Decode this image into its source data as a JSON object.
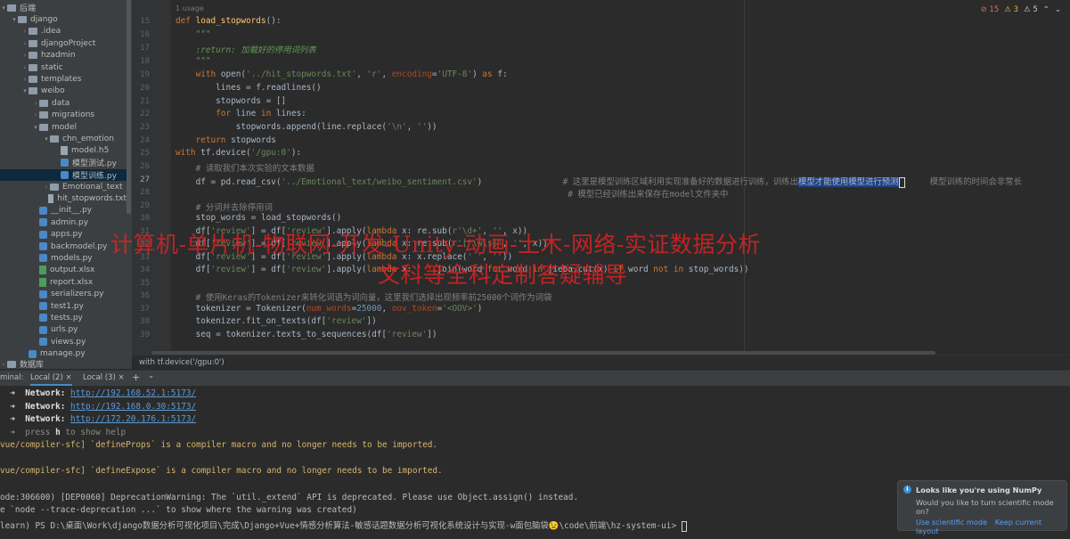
{
  "project_tree": {
    "items": [
      {
        "label": "后端",
        "depth": 0,
        "arrow": "▾",
        "icon": "folder-icon"
      },
      {
        "label": "django",
        "depth": 1,
        "arrow": "▾",
        "icon": "folder-icon"
      },
      {
        "label": ".idea",
        "depth": 2,
        "arrow": "›",
        "icon": "folder-icon"
      },
      {
        "label": "djangoProject",
        "depth": 2,
        "arrow": "›",
        "icon": "folder-icon"
      },
      {
        "label": "hzadmin",
        "depth": 2,
        "arrow": "›",
        "icon": "folder-icon"
      },
      {
        "label": "static",
        "depth": 2,
        "arrow": "›",
        "icon": "folder-icon"
      },
      {
        "label": "templates",
        "depth": 2,
        "arrow": "›",
        "icon": "folder-icon"
      },
      {
        "label": "weibo",
        "depth": 2,
        "arrow": "▾",
        "icon": "folder-icon"
      },
      {
        "label": "data",
        "depth": 3,
        "arrow": "›",
        "icon": "folder-icon"
      },
      {
        "label": "migrations",
        "depth": 3,
        "arrow": "›",
        "icon": "folder-icon"
      },
      {
        "label": "model",
        "depth": 3,
        "arrow": "▾",
        "icon": "folder-icon"
      },
      {
        "label": "chn_emotion",
        "depth": 4,
        "arrow": "▾",
        "icon": "folder-icon"
      },
      {
        "label": "model.h5",
        "depth": 5,
        "arrow": "",
        "icon": "file-icon"
      },
      {
        "label": "模型测试.py",
        "depth": 5,
        "arrow": "",
        "icon": "python-file-icon"
      },
      {
        "label": "模型训练.py",
        "depth": 5,
        "arrow": "",
        "icon": "python-file-icon",
        "selected": true
      },
      {
        "label": "Emotional_text",
        "depth": 4,
        "arrow": "›",
        "icon": "folder-icon"
      },
      {
        "label": "hit_stopwords.txt",
        "depth": 4,
        "arrow": "",
        "icon": "file-icon"
      },
      {
        "label": "__init__.py",
        "depth": 3,
        "arrow": "",
        "icon": "python-file-icon"
      },
      {
        "label": "admin.py",
        "depth": 3,
        "arrow": "",
        "icon": "python-file-icon"
      },
      {
        "label": "apps.py",
        "depth": 3,
        "arrow": "",
        "icon": "python-file-icon"
      },
      {
        "label": "backmodel.py",
        "depth": 3,
        "arrow": "",
        "icon": "python-file-icon"
      },
      {
        "label": "models.py",
        "depth": 3,
        "arrow": "",
        "icon": "python-file-icon"
      },
      {
        "label": "output.xlsx",
        "depth": 3,
        "arrow": "",
        "icon": "xlsx-file-icon"
      },
      {
        "label": "report.xlsx",
        "depth": 3,
        "arrow": "",
        "icon": "xlsx-file-icon"
      },
      {
        "label": "serializers.py",
        "depth": 3,
        "arrow": "",
        "icon": "python-file-icon"
      },
      {
        "label": "test1.py",
        "depth": 3,
        "arrow": "",
        "icon": "python-file-icon"
      },
      {
        "label": "tests.py",
        "depth": 3,
        "arrow": "",
        "icon": "python-file-icon"
      },
      {
        "label": "urls.py",
        "depth": 3,
        "arrow": "",
        "icon": "python-file-icon"
      },
      {
        "label": "views.py",
        "depth": 3,
        "arrow": "",
        "icon": "python-file-icon"
      },
      {
        "label": "manage.py",
        "depth": 2,
        "arrow": "",
        "icon": "python-file-icon"
      }
    ],
    "db_node": "数据库"
  },
  "editor": {
    "usage_hint": "1 usage",
    "inspections": {
      "errors": "15",
      "warnings": "3",
      "weak": "5"
    },
    "line_numbers": [
      "15",
      "16",
      "17",
      "18",
      "19",
      "20",
      "21",
      "22",
      "23",
      "24",
      "25",
      "26",
      "27",
      "28",
      "29",
      "30",
      "31",
      "32",
      "33",
      "34",
      "35",
      "36",
      "37",
      "38",
      "39"
    ],
    "breadcrumb": "with tf.device('/gpu:0')"
  },
  "terminal": {
    "label": "minal:",
    "tabs": [
      {
        "label": "Local (2)",
        "active": true
      },
      {
        "label": "Local (3)",
        "active": false
      }
    ],
    "add_label": "+",
    "menu_label": "⌄",
    "network_label": "Network:",
    "urls": [
      "http://192.168.52.1:5173/",
      "http://192.168.0.30:5173/",
      "http://172.20.176.1:5173/"
    ],
    "press_help_pre": "press ",
    "press_help_key": "h",
    "press_help_post": " to show help",
    "warn1_prefix": "vue/compiler-sfc]",
    "warn1_text": " `defineProps` is a compiler macro and no longer needs to be imported.",
    "warn2_prefix": "vue/compiler-sfc]",
    "warn2_text": " `defineExpose` is a compiler macro and no longer needs to be imported.",
    "deprecation": "ode:306600) [DEP0060] DeprecationWarning: The `util._extend` API is deprecated. Please use Object.assign() instead.",
    "trace_hint": "e `node --trace-deprecation ...` to show where the warning was created)",
    "prompt": "learn) PS D:\\桌面\\Work\\django数据分析可视化项目\\完成\\Django+Vue+情感分析算法-敏感话题数据分析可视化系统设计与实现-w面包脑袋😉\\code\\前端\\hz-system-ui> "
  },
  "notification": {
    "title": "Looks like you're using NumPy",
    "body": "Would you like to turn scientific mode on?",
    "link1": "Use scientific mode",
    "link2": "Keep current layout",
    "more": "..."
  },
  "watermark": {
    "line1": "计算机-单片机-物联网-开发-Unity-动画-土木-网络-实证数据分析",
    "line2": "文科等全科定制答疑辅导"
  },
  "colors": {
    "keyword": "#cc7832",
    "string": "#6a8759",
    "comment": "#808080",
    "function": "#ffc66d",
    "link": "#589df6",
    "watermark": "#e02323"
  }
}
